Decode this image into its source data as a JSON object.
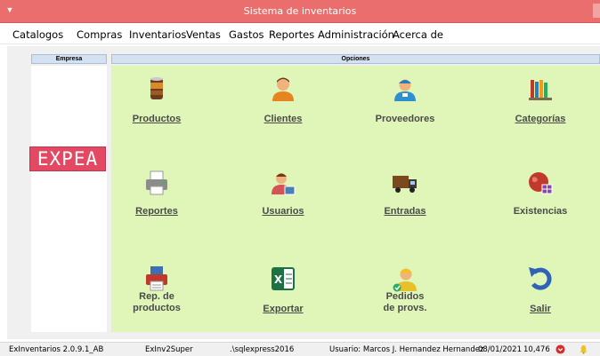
{
  "window": {
    "title": "Sistema de inventarios"
  },
  "menu": [
    {
      "label": "Catalogos"
    },
    {
      "label": "Compras"
    },
    {
      "label": "Inventarios"
    },
    {
      "label": "Ventas"
    },
    {
      "label": "Gastos"
    },
    {
      "label": "Reportes"
    },
    {
      "label": "Administración"
    },
    {
      "label": "Acerca de"
    }
  ],
  "empresa": {
    "header": "Empresa",
    "logo_text": "EXPEA"
  },
  "opciones": {
    "header": "Opciones",
    "tiles": [
      {
        "label": "Productos",
        "icon": "cans-icon"
      },
      {
        "label": "Clientes",
        "icon": "person-icon"
      },
      {
        "label": "Proveedores",
        "icon": "delivery-person-icon"
      },
      {
        "label": "Categorías",
        "icon": "books-icon"
      },
      {
        "label": "Reportes",
        "icon": "printer-icon"
      },
      {
        "label": "Usuarios",
        "icon": "user-card-icon"
      },
      {
        "label": "Entradas",
        "icon": "truck-icon"
      },
      {
        "label": "Existencias",
        "icon": "globe-table-icon"
      },
      {
        "label": "Rep. de\nproductos",
        "icon": "report-printer-icon"
      },
      {
        "label": "Exportar",
        "icon": "excel-icon"
      },
      {
        "label": "Pedidos\nde provs.",
        "icon": "order-person-icon"
      },
      {
        "label": "Salir",
        "icon": "undo-arrow-icon"
      }
    ]
  },
  "status": {
    "version": "ExInventarios 2.0.9.1_AB",
    "user_code": "ExInv2Super",
    "server": ".\\sqlexpress2016",
    "user": "Usuario: Marcos J. Hernandez Hernandez",
    "date": "08/01/2021",
    "count": "10,476"
  },
  "colors": {
    "titlebar": "#ea6e6e",
    "options_bg": "#e0f6b9",
    "header_bg": "#d3e1f0",
    "logo_bg": "#e34963"
  }
}
